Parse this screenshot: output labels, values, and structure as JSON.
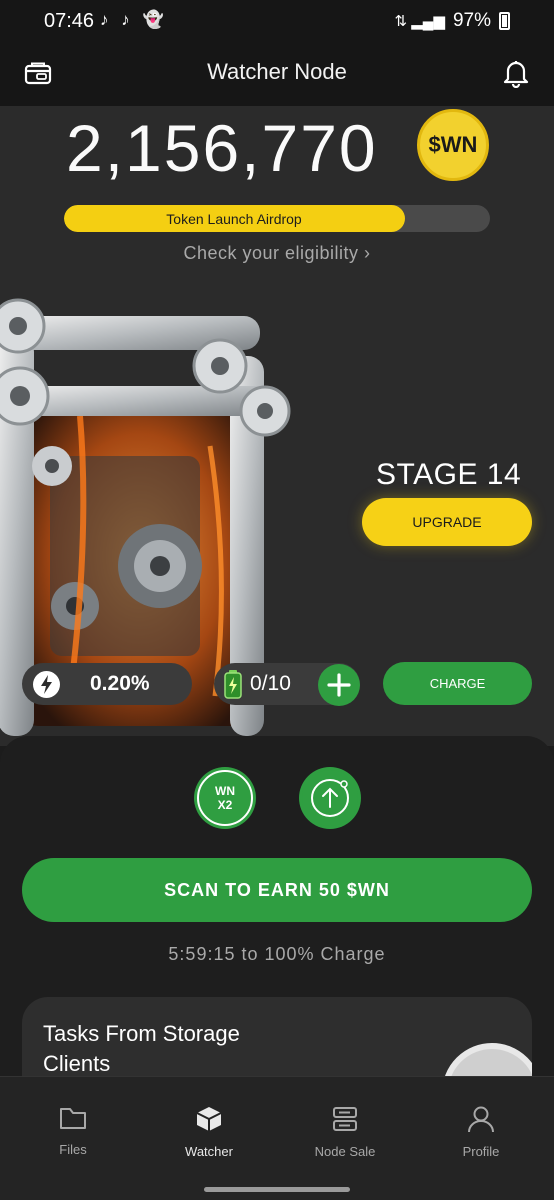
{
  "status_bar": {
    "time": "07:46",
    "app_icons": "♪ ♪ 👻",
    "battery_percent": "97%"
  },
  "header": {
    "title": "Watcher Node"
  },
  "balance": {
    "amount": "2,156,770",
    "coin_label": "$WN"
  },
  "airdrop": {
    "label": "Token Launch Airdrop",
    "progress": 0.8,
    "eligibility_text": "Check your eligibility ›"
  },
  "stage": {
    "title": "STAGE 14",
    "upgrade_label": "UPGRADE"
  },
  "stats": {
    "speed": "0.20%",
    "charges": "0/10",
    "charge_label": "CHARGE"
  },
  "boosts": {
    "x2_line1": "WN",
    "x2_line2": "X2"
  },
  "scan": {
    "label": "SCAN TO EARN 50 $WN",
    "countdown": "5:59:15 to 100% Charge"
  },
  "tasks": {
    "title": "Tasks From Storage Clients"
  },
  "nav": {
    "items": [
      {
        "label": "Files"
      },
      {
        "label": "Watcher"
      },
      {
        "label": "Node Sale"
      },
      {
        "label": "Profile"
      }
    ]
  },
  "colors": {
    "accent_yellow": "#f4cf12",
    "accent_green": "#2f9e41",
    "background": "#2b2b2b"
  }
}
